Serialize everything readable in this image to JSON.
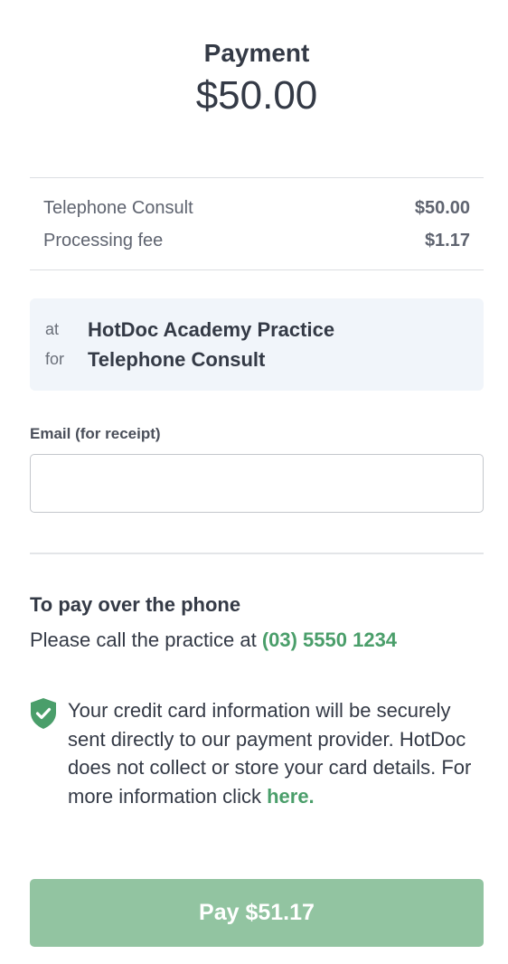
{
  "header": {
    "title": "Payment",
    "amount": "$50.00"
  },
  "line_items": [
    {
      "name": "Telephone Consult",
      "value": "$50.00"
    },
    {
      "name": "Processing fee",
      "value": "$1.17"
    }
  ],
  "appointment": {
    "at_label": "at",
    "at_value": "HotDoc Academy Practice",
    "for_label": "for",
    "for_value": "Telephone Consult"
  },
  "email": {
    "label": "Email (for receipt)",
    "value": "",
    "placeholder": ""
  },
  "phone": {
    "heading": "To pay over the phone",
    "prefix": "Please call the practice at ",
    "number": "(03) 5550 1234"
  },
  "security": {
    "icon": "shield-check-icon",
    "text": "Your credit card information will be securely sent directly to our payment provider. HotDoc does not collect or store your card details. For more information click ",
    "link": "here."
  },
  "pay_button": {
    "label": "Pay $51.17"
  },
  "colors": {
    "accent_green": "#4a9e6a",
    "button_green": "#92c4a1",
    "shield_green": "#4a9e6a",
    "info_background": "#f1f5fa",
    "text_dark": "#343a46"
  }
}
